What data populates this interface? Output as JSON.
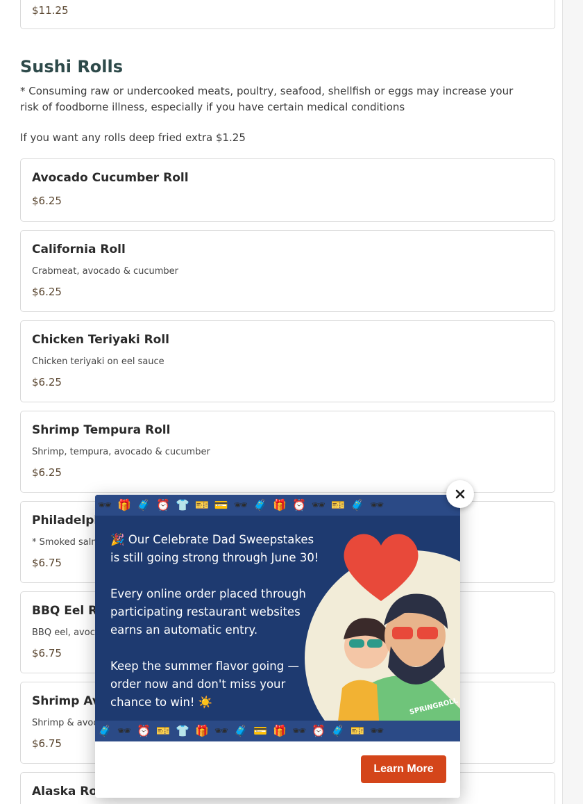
{
  "previous_item": {
    "price": "$11.25"
  },
  "section": {
    "title": "Sushi Rolls",
    "note": "* Consuming raw or undercooked meats, poultry, seafood, shellfish or eggs may increase your risk of foodborne illness, especially if you have certain medical conditions",
    "extra": "If you want any rolls deep fried extra $1.25"
  },
  "items": [
    {
      "name": "Avocado Cucumber Roll",
      "description": "",
      "price": "$6.25"
    },
    {
      "name": "California Roll",
      "description": "Crabmeat, avocado & cucumber",
      "price": "$6.25"
    },
    {
      "name": "Chicken Teriyaki Roll",
      "description": "Chicken teriyaki on eel sauce",
      "price": "$6.25"
    },
    {
      "name": "Shrimp Tempura Roll",
      "description": "Shrimp, tempura, avocado & cucumber",
      "price": "$6.25"
    },
    {
      "name": "Philadelph",
      "description": "* Smoked salm",
      "price": "$6.75"
    },
    {
      "name": "BBQ Eel Ro",
      "description": "BBQ eel, avoca",
      "price": "$6.75"
    },
    {
      "name": "Shrimp Avo",
      "description": "Shrimp & avoc",
      "price": "$6.75"
    },
    {
      "name": "Alaska Rol",
      "description": "",
      "price": ""
    }
  ],
  "popup": {
    "line1": "🎉 Our Celebrate Dad Sweepstakes",
    "line2": "is still going strong through June 30!",
    "line3": "Every online order placed through",
    "line4": "participating restaurant websites",
    "line5": "earns an automatic entry.",
    "line6": "Keep the summer flavor going —",
    "line7": "order now and don't miss your",
    "line8": "chance to win! ☀️",
    "shirt_text": "SPRINGROLL",
    "button_label": "Learn More",
    "close_icon": "close-icon",
    "colors": {
      "button": "#d4451a",
      "promo_bg": "#1e3a70",
      "heart": "#e8493a"
    }
  }
}
